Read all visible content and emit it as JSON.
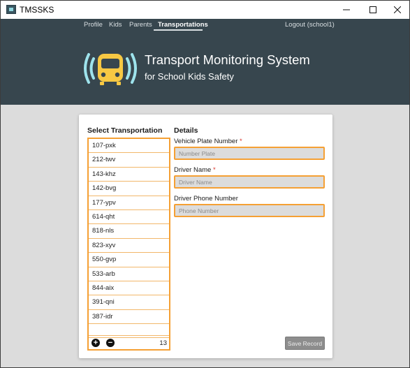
{
  "window": {
    "title": "TMSSKS"
  },
  "nav": {
    "items": [
      {
        "label": "Profile"
      },
      {
        "label": "Kids"
      },
      {
        "label": "Parents"
      },
      {
        "label": "Transportations"
      }
    ],
    "active": "Transportations",
    "logout_label": "Logout (school1)"
  },
  "header": {
    "title": "Transport Monitoring System",
    "subtitle": "for School Kids Safety",
    "logo_icon": "bus-signal-icon"
  },
  "colors": {
    "header_bg": "#37464e",
    "accent_orange": "#f5a034",
    "logo_yellow": "#f7c843",
    "logo_signal": "#9ee3ec"
  },
  "transport_list": {
    "title": "Select Transportation",
    "items": [
      "107-pxk",
      "212-twv",
      "143-khz",
      "142-bvg",
      "177-ypv",
      "614-qht",
      "818-nls",
      "823-xyv",
      "550-gvp",
      "533-arb",
      "844-aix",
      "391-qni",
      "387-idr"
    ],
    "count": "13"
  },
  "details": {
    "title": "Details",
    "plate": {
      "label": "Vehicle Plate Number",
      "required_mark": "*",
      "placeholder": "Number Plate",
      "value": ""
    },
    "driver": {
      "label": "Driver Name",
      "required_mark": "*",
      "placeholder": "Driver Name",
      "value": ""
    },
    "phone": {
      "label": "Driver Phone Number",
      "placeholder": "Phone Number",
      "value": ""
    },
    "save_label": "Save Record"
  }
}
